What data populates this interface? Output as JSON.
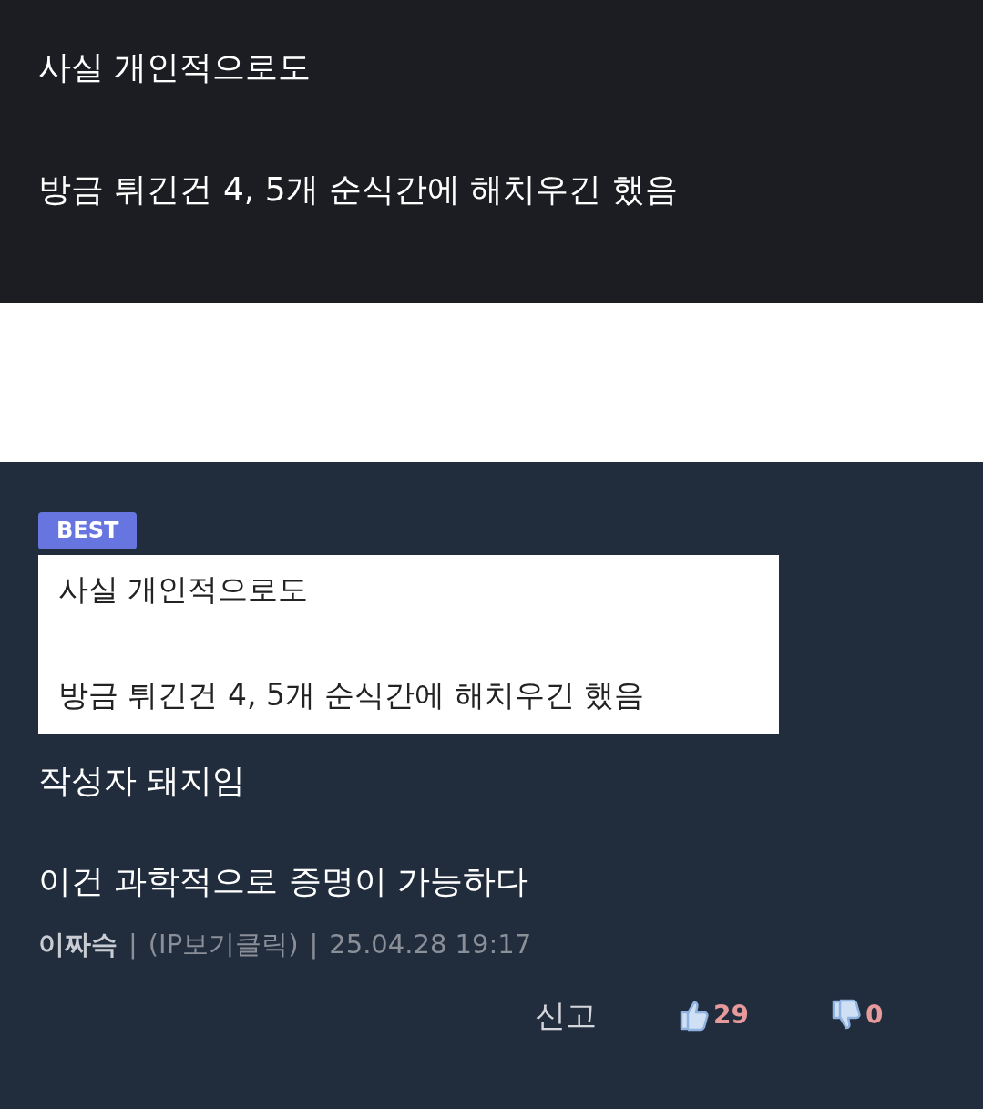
{
  "post_excerpt": {
    "lines": [
      "사실 개인적으로도",
      "방금 튀긴건 4, 5개 순식간에 해치우긴 했음"
    ]
  },
  "comment": {
    "badge": "BEST",
    "quote_lines": [
      "사실 개인적으로도",
      "방금 튀긴건 4, 5개 순식간에 해치우긴 했음"
    ],
    "text_lines": [
      "작성자 돼지임",
      "이건 과학적으로 증명이 가능하다"
    ],
    "author": "이짜슥",
    "separators": [
      "|",
      "|"
    ],
    "ip_link": "(IP보기클릭)",
    "timestamp": "25.04.28 19:17",
    "report": "신고",
    "likes": "29",
    "dislikes": "0"
  }
}
